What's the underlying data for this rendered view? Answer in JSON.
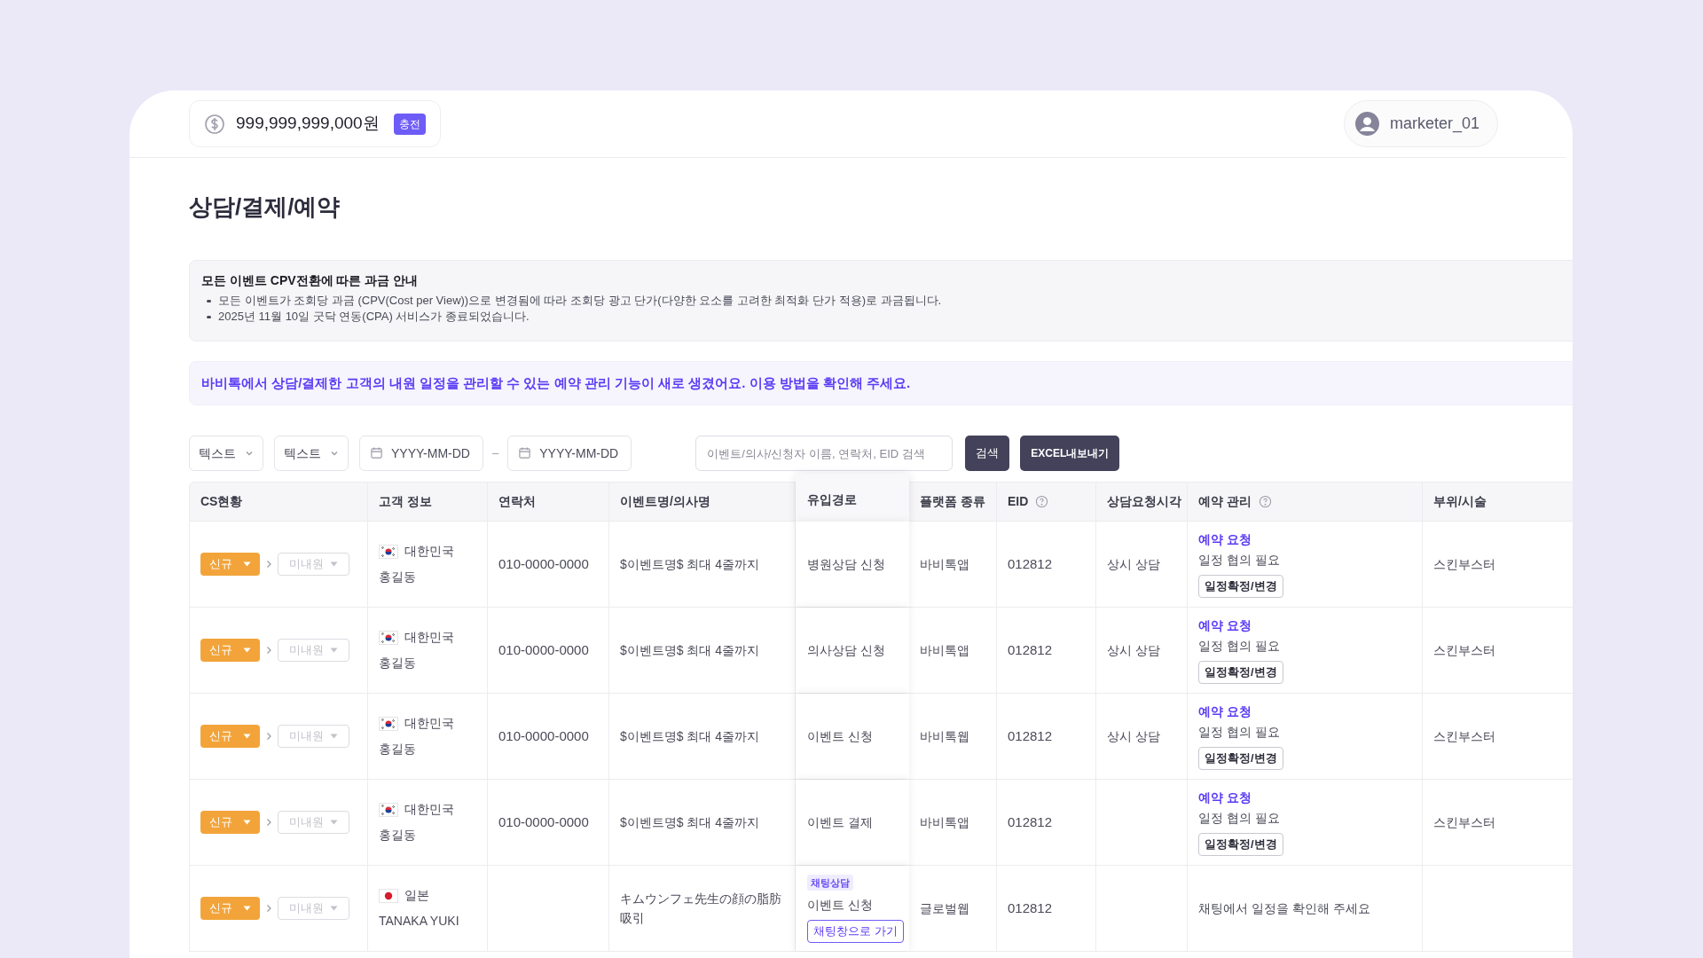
{
  "balance": {
    "amount": "999,999,999,000원",
    "charge_button": "충전"
  },
  "user": {
    "name": "marketer_01"
  },
  "page_title": "상담/결제/예약",
  "notice": {
    "title": "모든 이벤트 CPV전환에 따른 과금 안내",
    "items": [
      "모든 이벤트가 조회당 과금 (CPV(Cost per View))으로 변경됨에 따라 조회당 광고 단가(다양한 요소를 고려한 최적화 단가 적용)로 과금됩니다.",
      "2025년 11월 10일 굿닥 연동(CPA) 서비스가 종료되었습니다."
    ]
  },
  "announcement": "바비톡에서 상담/결제한 고객의 내원 일정을 관리할 수 있는 예약 관리 기능이 새로 생겼어요. 이용 방법을 확인해 주세요.",
  "filters": {
    "selects": [
      "텍스트",
      "텍스트"
    ],
    "date_from": {
      "placeholder": "YYYY-MM-DD"
    },
    "date_separator": "–",
    "date_to": {
      "placeholder": "YYYY-MM-DD"
    },
    "search": {
      "placeholder": "이벤트/의사/신청자 이름, 연락처, EID 검색"
    },
    "search_button": "검색",
    "export_button": "EXCEL내보내기"
  },
  "table": {
    "columns": [
      {
        "label": "CS현황",
        "help": false
      },
      {
        "label": "고객 정보",
        "help": false
      },
      {
        "label": "연락처",
        "help": false
      },
      {
        "label": "이벤트명/의사명",
        "help": false
      },
      {
        "label": "유입경로",
        "help": false
      },
      {
        "label": "플랫폼 종류",
        "help": false
      },
      {
        "label": "EID",
        "help": true
      },
      {
        "label": "상담요청시각",
        "help": false
      },
      {
        "label": "예약 관리",
        "help": true
      },
      {
        "label": "부위/시술",
        "help": false
      }
    ],
    "rows": [
      {
        "cs_status": "신규",
        "visit_status": "미내원",
        "flag": {
          "kind": "kr"
        },
        "country": "대한민국",
        "name": "홍길동",
        "phone": "010-0000-0000",
        "event": "$이벤트명$ 최대 4줄까지",
        "source": "병원상담 신청",
        "platform": "바비톡앱",
        "eid": "012812",
        "request_time": "상시 상담",
        "reservation": {
          "kind": "request",
          "status": "예약 요청",
          "note": "일정 협의 필요",
          "button": "일정확정/변경"
        },
        "area": "스킨부스터"
      },
      {
        "cs_status": "신규",
        "visit_status": "미내원",
        "flag": {
          "kind": "kr"
        },
        "country": "대한민국",
        "name": "홍길동",
        "phone": "010-0000-0000",
        "event": "$이벤트명$ 최대 4줄까지",
        "source": "의사상담 신청",
        "platform": "바비톡앱",
        "eid": "012812",
        "request_time": "상시 상담",
        "reservation": {
          "kind": "request",
          "status": "예약 요청",
          "note": "일정 협의 필요",
          "button": "일정확정/변경"
        },
        "area": "스킨부스터"
      },
      {
        "cs_status": "신규",
        "visit_status": "미내원",
        "flag": {
          "kind": "kr"
        },
        "country": "대한민국",
        "name": "홍길동",
        "phone": "010-0000-0000",
        "event": "$이벤트명$ 최대 4줄까지",
        "source": "이벤트 신청",
        "platform": "바비톡웹",
        "eid": "012812",
        "request_time": "상시 상담",
        "reservation": {
          "kind": "request",
          "status": "예약 요청",
          "note": "일정 협의 필요",
          "button": "일정확정/변경"
        },
        "area": "스킨부스터"
      },
      {
        "cs_status": "신규",
        "visit_status": "미내원",
        "flag": {
          "kind": "kr"
        },
        "country": "대한민국",
        "name": "홍길동",
        "phone": "010-0000-0000",
        "event": "$이벤트명$ 최대 4줄까지",
        "source": "이벤트 결제",
        "platform": "바비톡앱",
        "eid": "012812",
        "reservation": {
          "kind": "request",
          "status": "예약 요청",
          "note": "일정 협의 필요",
          "button": "일정확정/변경"
        },
        "area": "스킨부스터"
      },
      {
        "cs_status": "신규",
        "visit_status": "미내원",
        "flag": {
          "kind": "jp"
        },
        "country": "일본",
        "name": "TANAKA YUKI",
        "event": "キムウンフェ先生の顔の脂肪吸引",
        "source_tag": "채팅상담",
        "source": "이벤트 신청",
        "source_button": "채팅창으로 가기",
        "platform": "글로벌웹",
        "eid": "012812",
        "reservation": {
          "kind": "chat",
          "note": "채팅에서 일정을 확인해 주세요"
        }
      }
    ]
  }
}
